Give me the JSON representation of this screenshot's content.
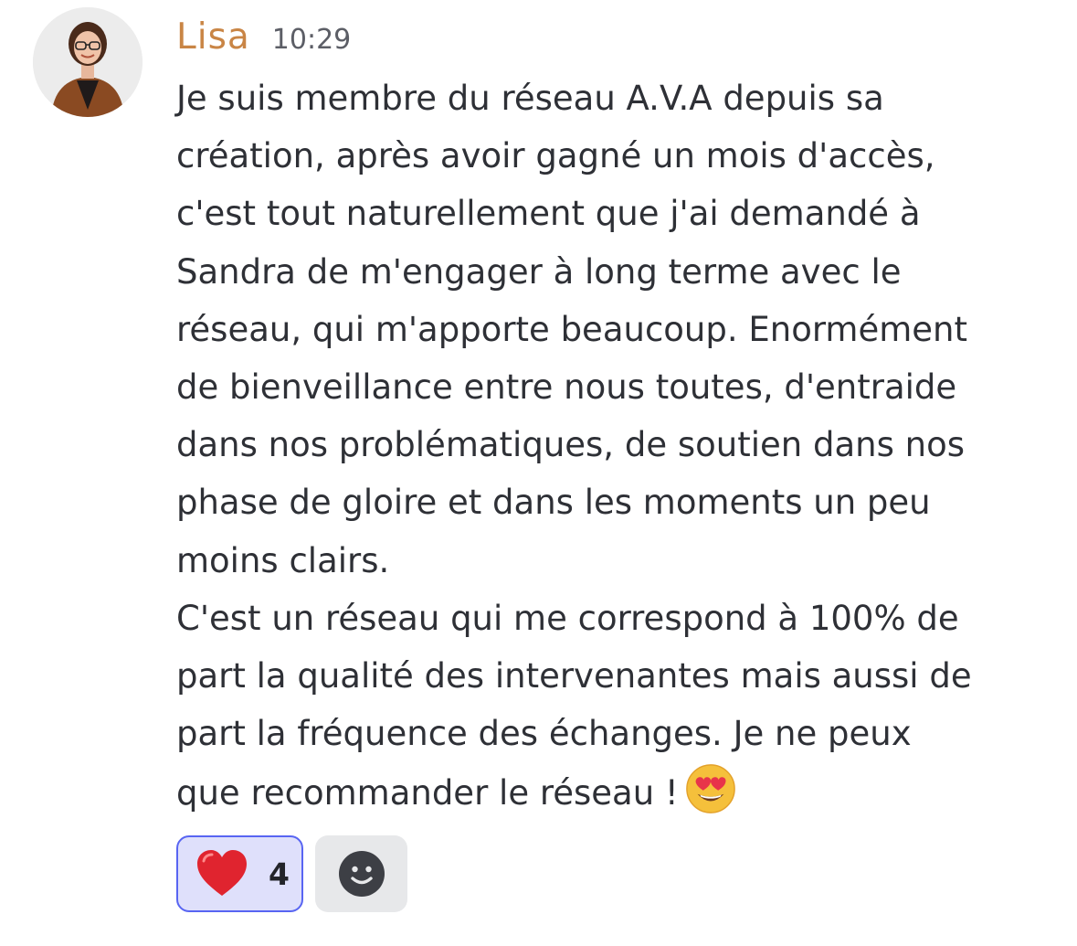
{
  "message": {
    "author": "Lisa",
    "timestamp": "10:29",
    "author_color": "#c98545",
    "lines": [
      "Je suis membre du réseau A.V.A depuis sa",
      "création, après avoir gagné un mois d'accès,",
      "c'est tout naturellement que j'ai demandé à",
      "Sandra de m'engager à long terme avec le",
      "réseau, qui m'apporte beaucoup. Enormément",
      "de bienveillance entre nous toutes, d'entraide",
      "dans nos problématiques, de soutien dans nos",
      "phase de gloire et dans les moments un peu",
      "moins clairs.",
      "C'est un réseau qui me correspond à 100% de",
      "part la qualité des intervenantes mais aussi de",
      "part la fréquence des échanges. Je ne peux",
      "que recommander le réseau !"
    ],
    "trailing_emoji": "smiling-face-with-heart-eyes"
  },
  "reactions": [
    {
      "emoji": "red-heart",
      "count": "4",
      "selected": true,
      "accent": "#5865f2"
    },
    {
      "emoji": "add-reaction-icon",
      "selected": false
    }
  ]
}
